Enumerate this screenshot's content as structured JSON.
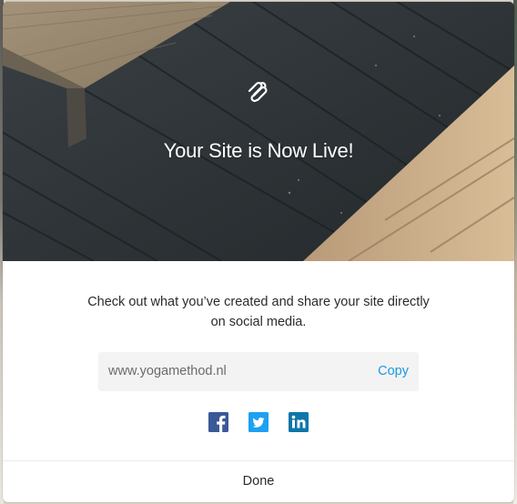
{
  "modal": {
    "hero": {
      "logo_icon": "squarespace-logo-icon",
      "title": "Your Site is Now Live!"
    },
    "description": "Check out what you’ve created and share your site directly on social media.",
    "url_box": {
      "url": "www.yogamethod.nl",
      "copy_label": "Copy"
    },
    "social": [
      {
        "icon": "facebook-icon",
        "color": "#3b5998"
      },
      {
        "icon": "twitter-icon",
        "color": "#1da1f2"
      },
      {
        "icon": "linkedin-icon",
        "color": "#0e76a8"
      }
    ],
    "done_label": "Done"
  },
  "colors": {
    "accent": "#1a9ae0",
    "url_box_bg": "#f3f3f3"
  }
}
